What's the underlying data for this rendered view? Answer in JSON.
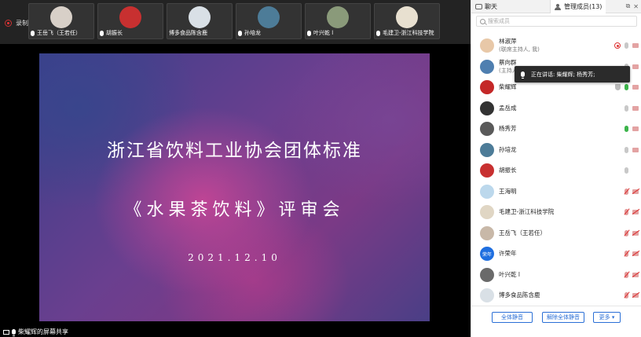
{
  "recording": {
    "label": "录制中"
  },
  "thumbnails": [
    {
      "name": "王岳飞（王若任）",
      "bg": "#d8d0c8"
    },
    {
      "name": "胡振长",
      "bg": "#c83030"
    },
    {
      "name": "博多食品陈含鹿",
      "bg": "#d9e0e6"
    },
    {
      "name": "孙培龙",
      "bg": "#4d7c98"
    },
    {
      "name": "叶兴乾 l",
      "bg": "#8a9a7a"
    },
    {
      "name": "毛建卫-浙江科技学院",
      "bg": "#e8e0d0"
    }
  ],
  "slide": {
    "title": "浙江省饮料工业协会团体标准",
    "subtitle": "《水果茶饮料》评审会",
    "date": "2021.12.10"
  },
  "share_label": "柴耀辉的屏幕共享",
  "panel": {
    "tab_chat": "聊天",
    "tab_members": "管理成员(13)",
    "search_placeholder": "搜索成员",
    "members": [
      {
        "name": "林淑萍",
        "sub": "(联席主持人, 我)",
        "avatar": "#e8c8a8",
        "mic": "gray",
        "rec": true,
        "cam": "on"
      },
      {
        "name": "蔡向群",
        "sub": "(主持人)",
        "avatar": "#4f7fb0",
        "mic": "gray",
        "cam": "on"
      },
      {
        "name": "柴耀辉",
        "avatar": "#c42828",
        "mic": "green",
        "shield": true,
        "cam": "on"
      },
      {
        "name": "孟岳成",
        "avatar": "#333333",
        "mic": "gray",
        "cam": "on"
      },
      {
        "name": "杨秀芳",
        "avatar": "#5a5a5a",
        "mic": "green",
        "cam": "on"
      },
      {
        "name": "孙培龙",
        "avatar": "#4d7c98",
        "mic": "gray",
        "cam": "on"
      },
      {
        "name": "胡振长",
        "avatar": "#c83030",
        "mic": "gray"
      },
      {
        "name": "王海明",
        "avatar": "#bcd8ec",
        "mic": "muted",
        "cam": "off"
      },
      {
        "name": "毛建卫-浙江科技学院",
        "avatar": "#e0d6c4",
        "mic": "muted",
        "cam": "off"
      },
      {
        "name": "王岳飞（王若任）",
        "avatar": "#c8b8a8",
        "mic": "muted",
        "cam": "off"
      },
      {
        "name": "许荣年",
        "avatar": "#1f6fe0",
        "avatar_text": "荣年",
        "mic": "muted",
        "cam": "off"
      },
      {
        "name": "叶兴乾 l",
        "avatar": "#6a6a6a",
        "mic": "muted",
        "cam": "off"
      },
      {
        "name": "博多食品陈含鹿",
        "avatar": "#d9e0e6",
        "mic": "muted",
        "cam": "off"
      }
    ],
    "tooltip": "正在讲话: 柴耀辉; 杨秀芳;",
    "buttons": {
      "mute_all": "全体静音",
      "unmute_all": "解除全体静音",
      "more": "更多 ▾"
    }
  }
}
